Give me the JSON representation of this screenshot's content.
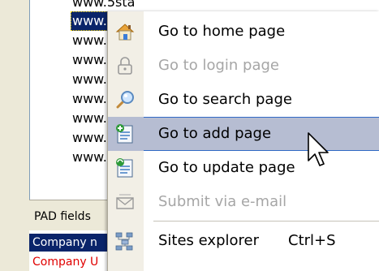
{
  "site_list": {
    "items": [
      {
        "text": "www.5sta"
      },
      {
        "text": "www.as"
      },
      {
        "text": "www.da"
      },
      {
        "text": "www.do"
      },
      {
        "text": "www.do"
      },
      {
        "text": "www.list"
      },
      {
        "text": "www.so"
      },
      {
        "text": "www.so"
      },
      {
        "text": "www.tuc"
      }
    ],
    "selected_index": 1
  },
  "pad_fields_tab": "PAD fields",
  "company_rows": [
    {
      "text": "Company n"
    },
    {
      "text": "Company U"
    }
  ],
  "context_menu": {
    "items": [
      {
        "label": "Go to home page",
        "icon": "home-icon",
        "enabled": true
      },
      {
        "label": "Go to login page",
        "icon": "lock-icon",
        "enabled": false
      },
      {
        "label": "Go to search page",
        "icon": "magnifier-icon",
        "enabled": true
      },
      {
        "label": "Go to add page",
        "icon": "add-page-icon",
        "enabled": true,
        "highlighted": true
      },
      {
        "label": "Go to update page",
        "icon": "update-page-icon",
        "enabled": true
      },
      {
        "label": "Submit via e-mail",
        "icon": "mail-icon",
        "enabled": false
      },
      {
        "label": "Sites explorer",
        "icon": "sites-explorer-icon",
        "enabled": true,
        "shortcut": "Ctrl+S"
      }
    ]
  }
}
